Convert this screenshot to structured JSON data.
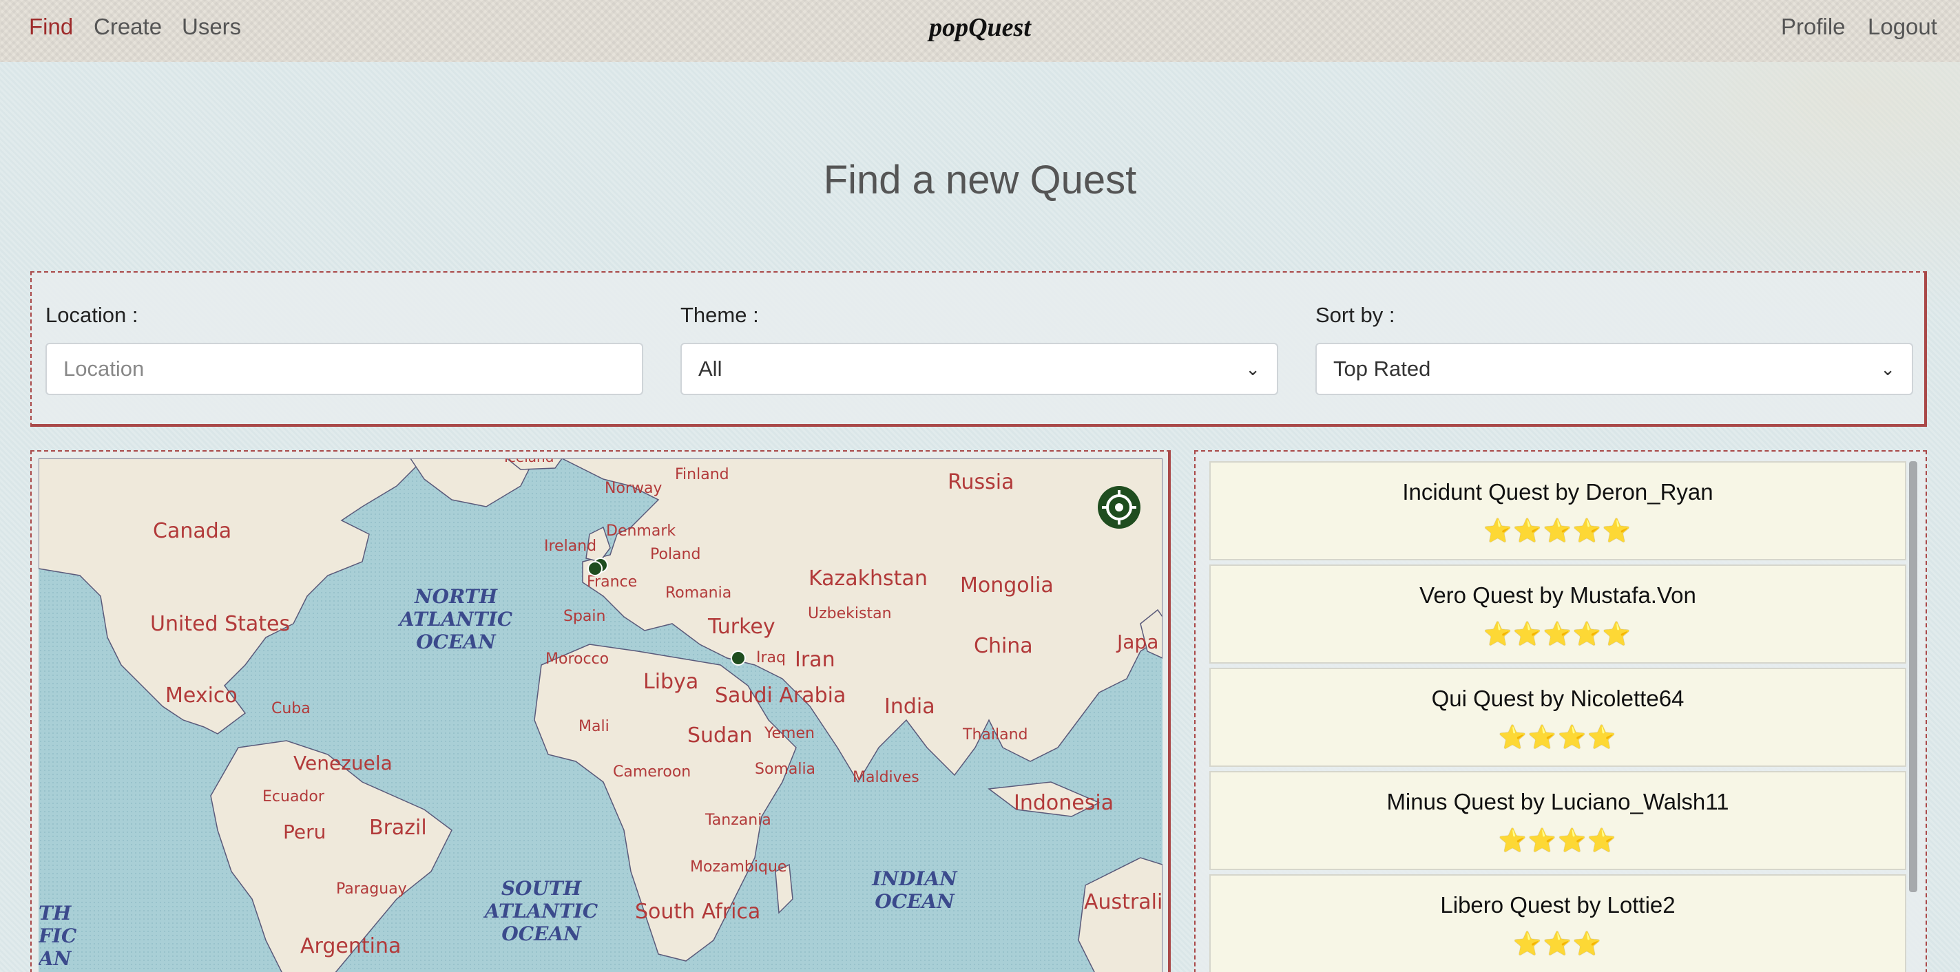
{
  "nav": {
    "left_links": [
      "Find",
      "Create",
      "Users"
    ],
    "brand": "popQuest",
    "right_links": [
      "Profile",
      "Logout"
    ],
    "active": "Find"
  },
  "page": {
    "title": "Find a new Quest"
  },
  "filters": {
    "location": {
      "label": "Location :",
      "placeholder": "Location",
      "value": ""
    },
    "theme": {
      "label": "Theme :",
      "selected": "All"
    },
    "sort": {
      "label": "Sort by :",
      "selected": "Top Rated"
    }
  },
  "map": {
    "labels": {
      "canada": "Canada",
      "united_states": "United States",
      "mexico": "Mexico",
      "cuba": "Cuba",
      "venezuela": "Venezuela",
      "ecuador": "Ecuador",
      "peru": "Peru",
      "brazil": "Brazil",
      "paraguay": "Paraguay",
      "argentina": "Argentina",
      "iceland": "Iceland",
      "norway": "Norway",
      "finland": "Finland",
      "russia": "Russia",
      "ireland": "Ireland",
      "denmark": "Denmark",
      "poland": "Poland",
      "france": "France",
      "romania": "Romania",
      "spain": "Spain",
      "kazakhstan": "Kazakhstan",
      "mongolia": "Mongolia",
      "uzbekistan": "Uzbekistan",
      "turkey": "Turkey",
      "morocco": "Morocco",
      "iraq": "Iraq",
      "iran": "Iran",
      "china": "China",
      "japan": "Japa",
      "libya": "Libya",
      "saudi_arabia": "Saudi Arabia",
      "india": "India",
      "mali": "Mali",
      "sudan": "Sudan",
      "yemen": "Yemen",
      "thailand": "Thailand",
      "somalia": "Somalia",
      "cameroon": "Cameroon",
      "maldives": "Maldives",
      "indonesia": "Indonesia",
      "tanzania": "Tanzania",
      "mozambique": "Mozambique",
      "south_africa": "South Africa",
      "australia": "Australi",
      "north_atlantic": [
        "NORTH",
        "ATLANTIC",
        "OCEAN"
      ],
      "south_atlantic": [
        "SOUTH",
        "ATLANTIC",
        "OCEAN"
      ],
      "indian_ocean": [
        "INDIAN",
        "OCEAN"
      ],
      "pacific_fragment": [
        "TH",
        "FIC",
        "AN"
      ]
    },
    "marker_color": "#1f4d1f",
    "locate_icon": "crosshair-icon"
  },
  "quests": [
    {
      "title": "Incidunt Quest by Deron_Ryan",
      "rating": 5,
      "stars": "⭐⭐⭐⭐⭐"
    },
    {
      "title": "Vero Quest by Mustafa.Von",
      "rating": 5,
      "stars": "⭐⭐⭐⭐⭐"
    },
    {
      "title": "Qui Quest by Nicolette64",
      "rating": 4,
      "stars": "⭐⭐⭐⭐"
    },
    {
      "title": "Minus Quest by Luciano_Walsh11",
      "rating": 4,
      "stars": "⭐⭐⭐⭐"
    },
    {
      "title": "Libero Quest by Lottie2",
      "rating": 3,
      "stars": "⭐⭐⭐"
    }
  ],
  "colors": {
    "accent": "#9e2b2b",
    "panel_border": "#a94848",
    "card_bg": "#f7f6e6",
    "star": "#f1c232"
  }
}
